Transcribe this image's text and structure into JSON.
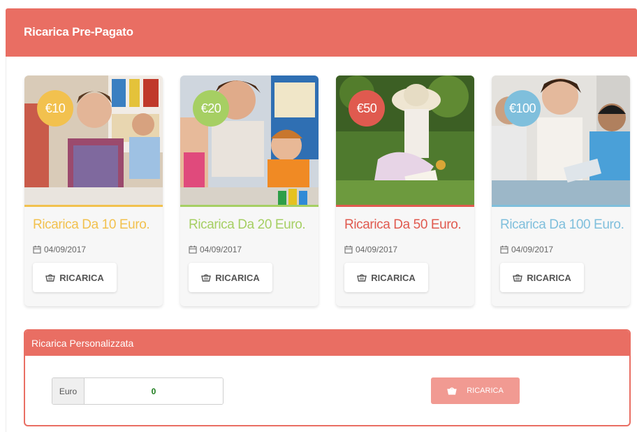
{
  "panel": {
    "title": "Ricarica Pre-Pagato"
  },
  "cards": [
    {
      "price": "€10",
      "title": "Ricarica Da 10 Euro.",
      "date": "04/09/2017",
      "button": "RICARICA",
      "color": "#f2c14e"
    },
    {
      "price": "€20",
      "title": "Ricarica Da 20 Euro.",
      "date": "04/09/2017",
      "button": "RICARICA",
      "color": "#a6cf63"
    },
    {
      "price": "€50",
      "title": "Ricarica Da 50 Euro.",
      "date": "04/09/2017",
      "button": "RICARICA",
      "color": "#e05a4f"
    },
    {
      "price": "€100",
      "title": "Ricarica Da 100 Euro.",
      "date": "04/09/2017",
      "button": "RICARICA",
      "color": "#7fbfdc"
    }
  ],
  "custom": {
    "title": "Ricarica Personalizzata",
    "addon": "Euro",
    "value": "0",
    "button": "RICARICA"
  },
  "icons": {
    "date": "calendar-icon",
    "button": "basket-icon"
  },
  "colors": {
    "accent": "#e96e63",
    "button_disabled": "#f19a92",
    "value": "#1e7d1e"
  }
}
